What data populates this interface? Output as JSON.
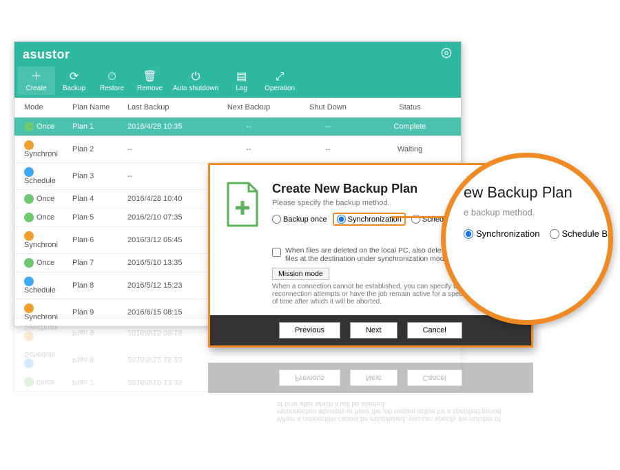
{
  "brand": "asustor",
  "toolbar": {
    "create": "Create",
    "backup": "Backup",
    "restore": "Restore",
    "remove": "Remove",
    "autoshutdown": "Auto shutdown",
    "log": "Log",
    "operation": "Operation"
  },
  "columns": {
    "mode": "Mode",
    "plan": "Plan Name",
    "last": "Last Backup",
    "next": "Next Backup",
    "shut": "Shut Down",
    "status": "Status"
  },
  "rows": [
    {
      "mode": "Once",
      "icon": "once",
      "plan": "Plan 1",
      "last": "2016/4/28 10:35",
      "next": "--",
      "shut": "--",
      "status": "Complete",
      "sel": true
    },
    {
      "mode": "Synchroni",
      "icon": "sync",
      "plan": "Plan 2",
      "last": "--",
      "next": "--",
      "shut": "--",
      "status": "Waiting"
    },
    {
      "mode": "Schedule",
      "icon": "sched",
      "plan": "Plan 3",
      "last": "--",
      "next": "",
      "shut": "",
      "status": ""
    },
    {
      "mode": "Once",
      "icon": "once",
      "plan": "Plan 4",
      "last": "2016/4/28 10:40",
      "next": "",
      "shut": "",
      "status": ""
    },
    {
      "mode": "Once",
      "icon": "once",
      "plan": "Plan 5",
      "last": "2016/2/10 07:35",
      "next": "",
      "shut": "",
      "status": ""
    },
    {
      "mode": "Synchroni",
      "icon": "sync",
      "plan": "Plan 6",
      "last": "2016/3/12 05:45",
      "next": "",
      "shut": "",
      "status": ""
    },
    {
      "mode": "Once",
      "icon": "once",
      "plan": "Plan 7",
      "last": "2016/5/10 13:35",
      "next": "",
      "shut": "",
      "status": ""
    },
    {
      "mode": "Schedule",
      "icon": "sched",
      "plan": "Plan 8",
      "last": "2016/5/12 15:23",
      "next": "",
      "shut": "",
      "status": ""
    },
    {
      "mode": "Synchroni",
      "icon": "sync",
      "plan": "Plan 9",
      "last": "2016/6/15 08:15",
      "next": "",
      "shut": "",
      "status": ""
    }
  ],
  "tool_icons": {
    "create": "＋",
    "backup": "⟳",
    "restore": "⏱",
    "remove": "🗑",
    "autoshutdown": "⏻",
    "log": "▤",
    "operation": "⤢"
  },
  "dialog": {
    "title": "Create New Backup Plan",
    "subtitle": "Please specify the backup method.",
    "radio_once": "Backup once",
    "radio_sync": "Synchronization",
    "radio_sched": "Schedule Backup",
    "chk_delete": "When files are deleted on the local PC, also delete the corresponding files at the destination under synchronization mode.",
    "mission_btn": "Mission mode",
    "mission_txt": "When a connection cannot be established, you can specify the number of reconnection attempts or have the job remain active for a specified period of time after which it will be aborted.",
    "prev": "Previous",
    "next": "Next",
    "cancel": "Cancel"
  },
  "lens": {
    "title_frag": "ew Backup Plan",
    "sub_frag": "e backup method.",
    "radio_sync": "Synchronization",
    "radio_sched": "Schedule Ba"
  }
}
